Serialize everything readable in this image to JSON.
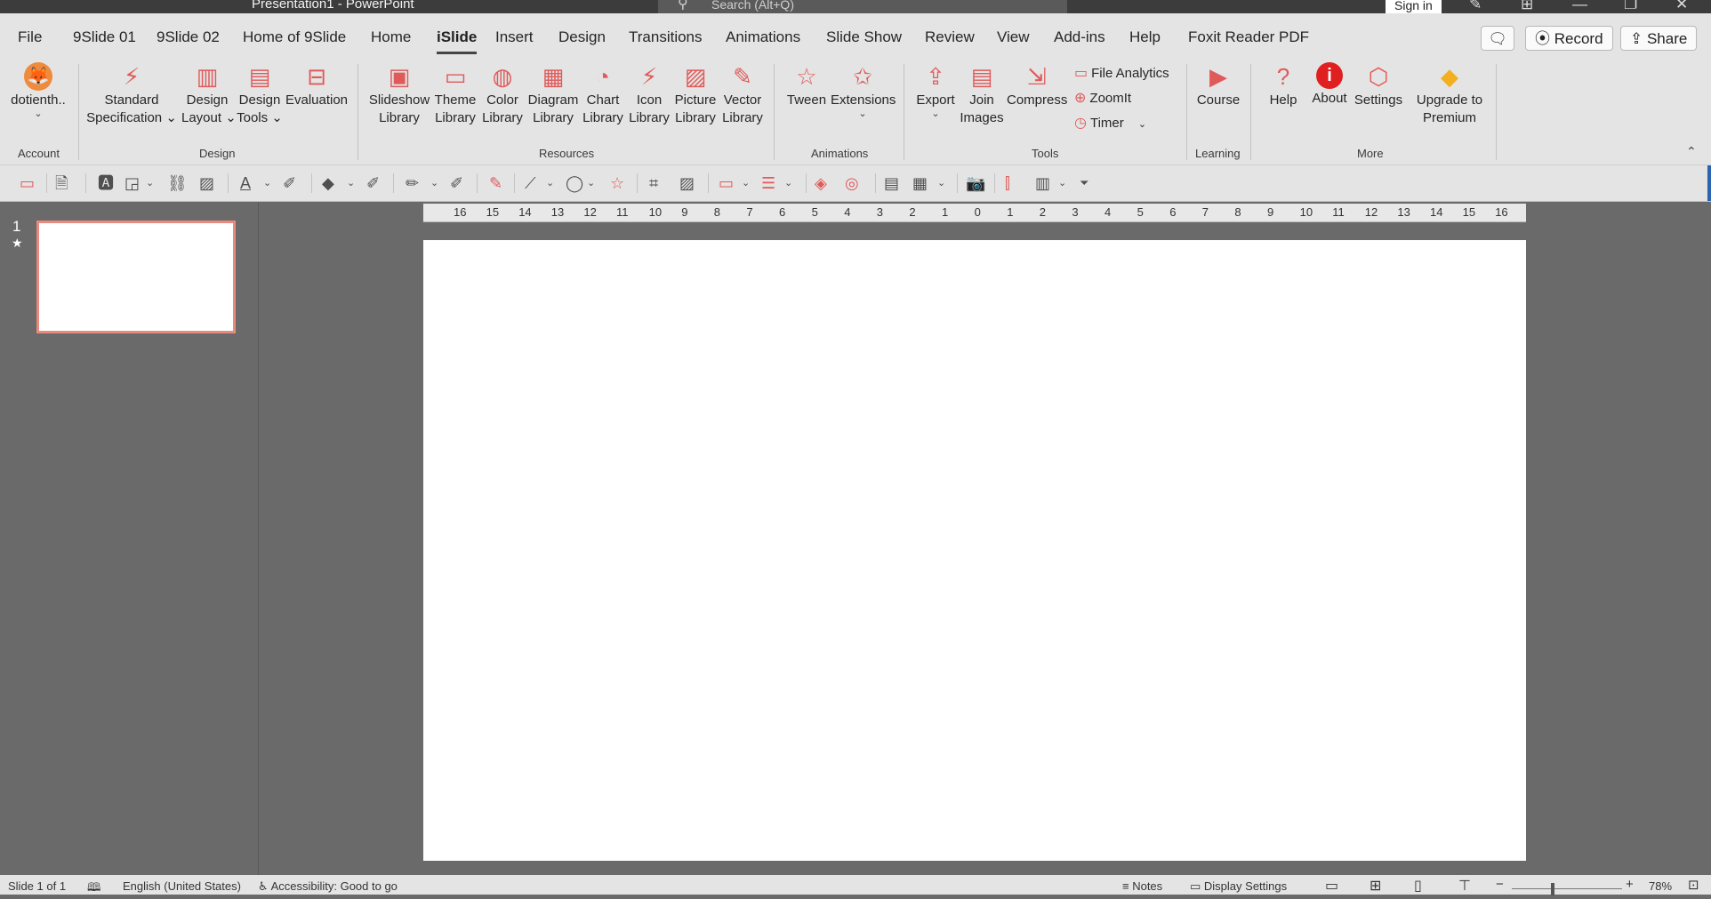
{
  "titlebar": {
    "title": "Presentation1  -  PowerPoint",
    "search_placeholder": "Search (Alt+Q)",
    "sign_in": "Sign in",
    "minimize": "—",
    "restore": "❐",
    "close": "✕"
  },
  "tabs": [
    "File",
    "9Slide 01",
    "9Slide 02",
    "Home of 9Slide",
    "Home",
    "iSlide",
    "Insert",
    "Design",
    "Transitions",
    "Animations",
    "Slide Show",
    "Review",
    "View",
    "Add-ins",
    "Help",
    "Foxit Reader PDF"
  ],
  "active_tab": "iSlide",
  "tab_right": {
    "record": "Record",
    "share": "Share"
  },
  "ribbon": {
    "account": {
      "label": "dotienth..",
      "group": "Account"
    },
    "design": {
      "group": "Design",
      "standard_specification": [
        "Standard",
        "Specification"
      ],
      "design_layout": [
        "Design",
        "Layout"
      ],
      "design_tools": [
        "Design",
        "Tools"
      ],
      "evaluation": "Evaluation"
    },
    "resources": {
      "group": "Resources",
      "slideshow_library": [
        "Slideshow",
        "Library"
      ],
      "theme_library": [
        "Theme",
        "Library"
      ],
      "color_library": [
        "Color",
        "Library"
      ],
      "diagram_library": [
        "Diagram",
        "Library"
      ],
      "chart_library": [
        "Chart",
        "Library"
      ],
      "icon_library": [
        "Icon",
        "Library"
      ],
      "picture_library": [
        "Picture",
        "Library"
      ],
      "vector_library": [
        "Vector",
        "Library"
      ]
    },
    "animations": {
      "group": "Animations",
      "tween": "Tween",
      "extensions": "Extensions"
    },
    "tools": {
      "group": "Tools",
      "export": "Export",
      "join_images": [
        "Join",
        "Images"
      ],
      "compress": "Compress",
      "file_analytics": "File Analytics",
      "zoomit": "ZoomIt",
      "timer": "Timer"
    },
    "learning": {
      "group": "Learning",
      "course": "Course"
    },
    "more": {
      "group": "More",
      "help": "Help",
      "about": "About",
      "settings": "Settings",
      "upgrade": [
        "Upgrade to",
        "Premium"
      ]
    }
  },
  "slides_pane": {
    "slide_number": "1",
    "star": "★"
  },
  "ruler_labels": [
    "16",
    "15",
    "14",
    "13",
    "12",
    "11",
    "10",
    "9",
    "8",
    "7",
    "6",
    "5",
    "4",
    "3",
    "2",
    "1",
    "0",
    "1",
    "2",
    "3",
    "4",
    "5",
    "6",
    "7",
    "8",
    "9",
    "10",
    "11",
    "12",
    "13",
    "14",
    "15",
    "16"
  ],
  "status": {
    "slide": "Slide 1 of 1",
    "language": "English (United States)",
    "accessibility": "Accessibility: Good to go",
    "notes": "Notes",
    "display_settings": "Display Settings",
    "zoom": "78%"
  },
  "colors": {
    "accent": "#e05a5a",
    "titlebar": "#3c3c3c",
    "ribbon": "#e4e4e4",
    "workspace": "#6a6a6a"
  }
}
